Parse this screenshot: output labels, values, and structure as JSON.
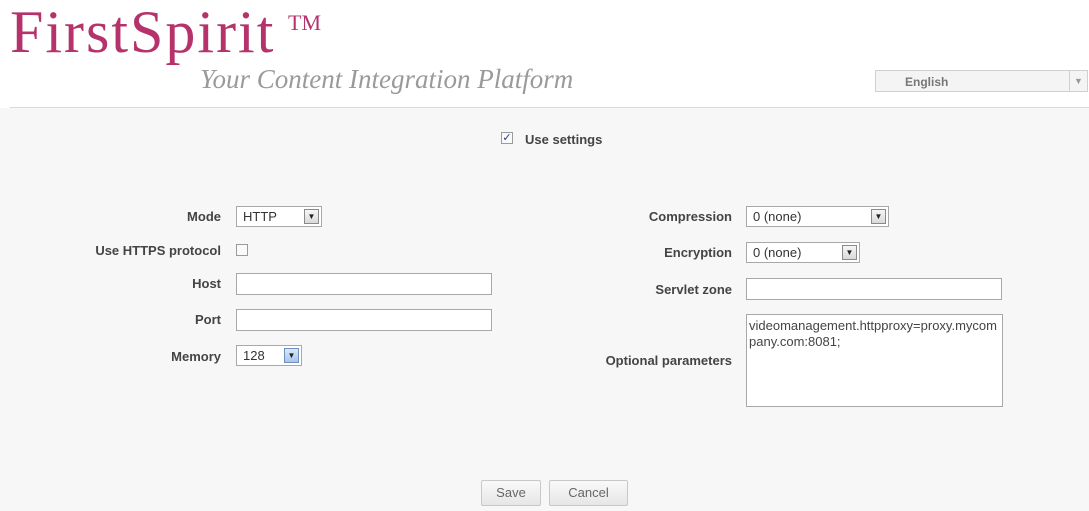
{
  "header": {
    "logo_text": "FirstSpirit",
    "logo_tm": "TM",
    "tagline": "Your Content Integration Platform",
    "language": "English"
  },
  "form": {
    "use_settings_label": "Use settings",
    "use_settings_checked": true,
    "mode_label": "Mode",
    "mode_value": "HTTP",
    "https_label": "Use HTTPS protocol",
    "https_checked": false,
    "host_label": "Host",
    "host_value": "",
    "port_label": "Port",
    "port_value": "",
    "memory_label": "Memory",
    "memory_value": "128",
    "compression_label": "Compression",
    "compression_value": "0 (none)",
    "encryption_label": "Encryption",
    "encryption_value": "0 (none)",
    "servlet_label": "Servlet zone",
    "servlet_value": "",
    "optional_label": "Optional parameters",
    "optional_value": "videomanagement.httpproxy=proxy.mycompany.com:8081;"
  },
  "buttons": {
    "save": "Save",
    "cancel": "Cancel"
  },
  "colors": {
    "brand": "#b5336a",
    "tagline": "#9a9a9a",
    "background": "#f7f7f7"
  }
}
